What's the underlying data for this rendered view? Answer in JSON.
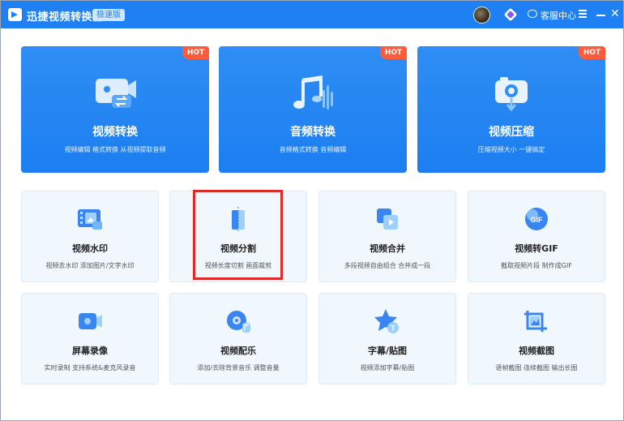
{
  "app": {
    "title": "迅捷视频转换器",
    "edition": "极速版",
    "service_label": "客服中心"
  },
  "icons": {
    "logo": "app-logo-icon",
    "vip": "vip-diamond-icon",
    "service": "chat-icon",
    "menu": "hamburger-menu-icon",
    "minimize": "minimize-icon",
    "close": "close-icon"
  },
  "colors": {
    "accent": "#1f80f3",
    "hot": "#ff5a3a",
    "highlight": "#e02a2a",
    "card_bg": "#f0f8fe"
  },
  "big_cards": [
    {
      "title": "视频转换",
      "desc": "视频编辑 格式转换 从视频提取音频",
      "hot": "HOT",
      "icon": "video-convert-icon"
    },
    {
      "title": "音频转换",
      "desc": "音频格式转换 音频编辑",
      "hot": "HOT",
      "icon": "audio-convert-icon"
    },
    {
      "title": "视频压缩",
      "desc": "压缩视频大小 一键搞定",
      "hot": "HOT",
      "icon": "video-compress-icon"
    }
  ],
  "small_cards": [
    {
      "title": "视频水印",
      "desc": "视频去水印 添加图片/文字水印",
      "icon": "watermark-icon"
    },
    {
      "title": "视频分割",
      "desc": "视频长度切割 画面裁剪",
      "icon": "split-icon"
    },
    {
      "title": "视频合并",
      "desc": "多段视频自由组合 合并成一段",
      "icon": "merge-icon"
    },
    {
      "title": "视频转GIF",
      "desc": "截取视频片段 制作成GIF",
      "icon": "gif-icon"
    },
    {
      "title": "屏幕录像",
      "desc": "实时录制 支持系统&麦克风录音",
      "icon": "screen-record-icon"
    },
    {
      "title": "视频配乐",
      "desc": "添加/去除背景音乐 调整音量",
      "icon": "music-icon"
    },
    {
      "title": "字幕/贴图",
      "desc": "视频添加字幕/贴图",
      "icon": "subtitle-sticker-icon"
    },
    {
      "title": "视频截图",
      "desc": "逐帧截图 连续截图 输出长图",
      "icon": "screenshot-icon"
    }
  ]
}
